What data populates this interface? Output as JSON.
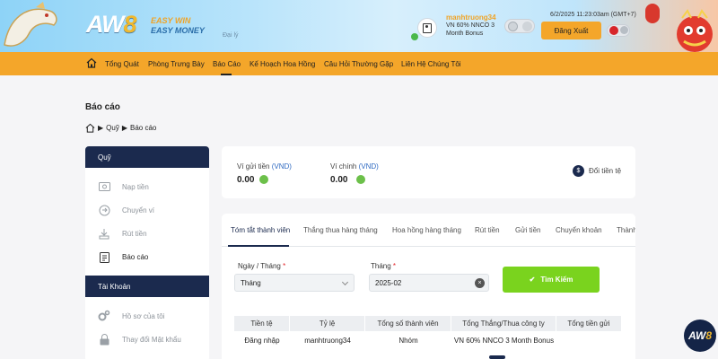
{
  "header": {
    "logo_text": "AW",
    "logo_number": "8",
    "tagline1": "EASY WIN",
    "tagline2": "EASY MONEY",
    "agent_tag": "Đại lý",
    "username": "manhtruong34",
    "plan": "VN 60% NNCO 3 Month Bonus",
    "datetime": "6/2/2025 11:23:03am (GMT+7)",
    "logout_label": "Đăng Xuất"
  },
  "nav": {
    "items": [
      "Tổng Quát",
      "Phòng Trưng Bày",
      "Báo Cáo",
      "Kế Hoạch Hoa Hồng",
      "Câu Hỏi Thường Gặp",
      "Liên Hệ Chúng Tôi"
    ],
    "active": "Báo Cáo"
  },
  "page": {
    "title": "Báo cáo",
    "breadcrumb": [
      "Quỹ",
      "Báo cáo"
    ]
  },
  "sidebar": {
    "section1": "Quỹ",
    "items1": [
      "Nạp tiền",
      "Chuyển ví",
      "Rút tiền",
      "Báo cáo"
    ],
    "section2": "Tài Khoản",
    "items2": [
      "Hồ sơ của tôi",
      "Thay đổi Mật khẩu"
    ]
  },
  "balance": {
    "wallet_label": "Ví gửi tiền",
    "main_label": "Ví chính",
    "currency": "(VND)",
    "wallet_value": "0.00",
    "main_value": "0.00",
    "exchange_label": "Đổi tiền tệ"
  },
  "tabs": [
    "Tóm tắt thành viên",
    "Thắng thua hàng tháng",
    "Hoa hồng hàng tháng",
    "Rút tiền",
    "Gửi tiền",
    "Chuyển khoản",
    "Thành"
  ],
  "filters": {
    "type_label": "Ngày / Tháng",
    "type_value": "Tháng",
    "month_label": "Tháng",
    "month_value": "2025-02",
    "required_mark": "*",
    "search_label": "Tìm Kiếm"
  },
  "table": {
    "headers": [
      "Tiền tệ",
      "Tỷ lệ",
      "Tổng số thành viên",
      "Tổng Thắng/Thua công ty",
      "Tổng tiền gửi"
    ],
    "row": [
      "Đăng nhập",
      "manhtruong34",
      "Nhóm",
      "VN 60% NNCO 3 Month Bonus",
      ""
    ]
  },
  "colors": {
    "accent": "#f4a62a",
    "navy": "#1b2a4e",
    "green": "#7ad31e",
    "currency_blue": "#2f6ac2"
  }
}
